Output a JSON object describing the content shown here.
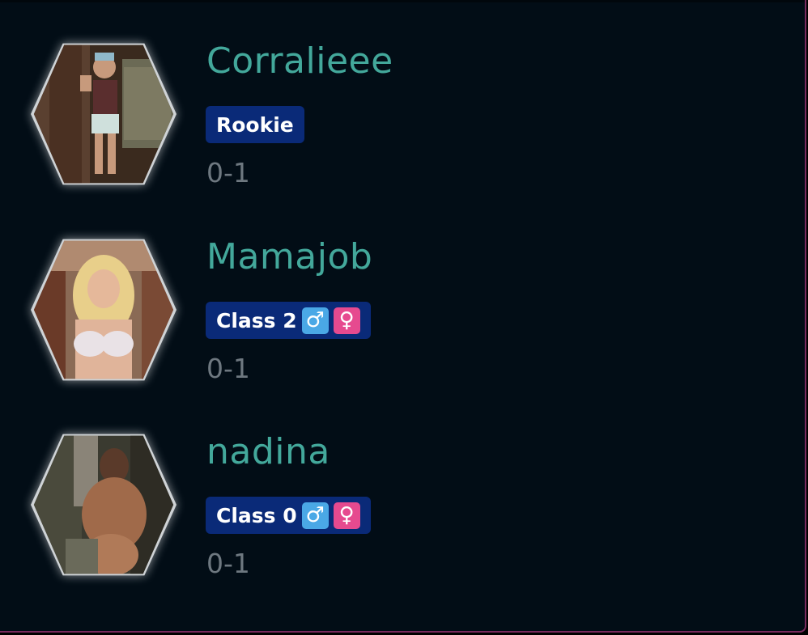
{
  "colors": {
    "panel_bg": "#020d16",
    "panel_border": "#7a2a5e",
    "name_color": "#43a89b",
    "badge_bg": "#0a2a78",
    "record_color": "#6e7880",
    "male_bg": "#4aa8e6",
    "female_bg": "#e64a8f"
  },
  "players": [
    {
      "name": "Corralieee",
      "badge": "Rookie",
      "show_gender_icons": false,
      "record": "0-1",
      "avatar_icon": "player-avatar-photo"
    },
    {
      "name": "Mamajob",
      "badge": "Class 2",
      "show_gender_icons": true,
      "male_symbol": "♂",
      "female_symbol": "♀",
      "record": "0-1",
      "avatar_icon": "player-avatar-photo"
    },
    {
      "name": "nadina",
      "badge": "Class 0",
      "show_gender_icons": true,
      "male_symbol": "♂",
      "female_symbol": "♀",
      "record": "0-1",
      "avatar_icon": "player-avatar-photo"
    }
  ]
}
